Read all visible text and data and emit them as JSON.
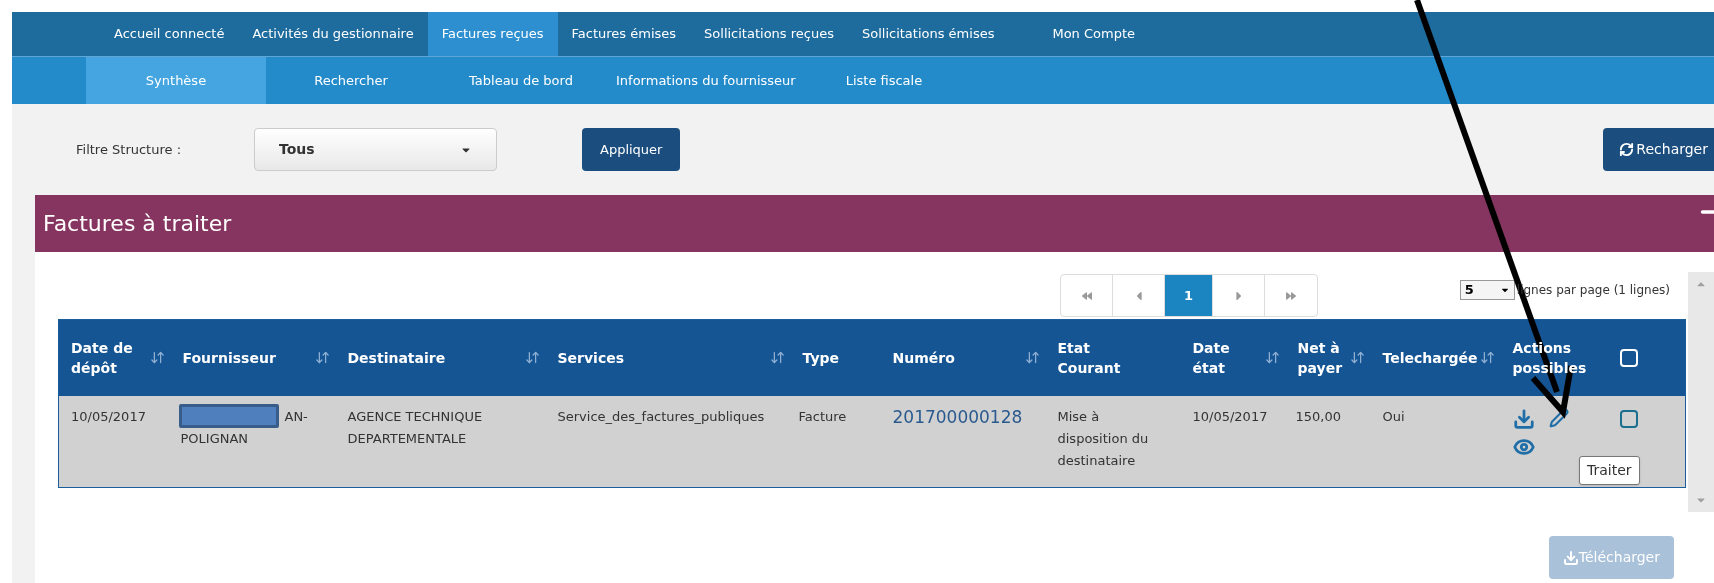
{
  "nav": {
    "tabs": [
      {
        "label": "Accueil connecté",
        "selected": false
      },
      {
        "label": "Activités du gestionnaire",
        "selected": false
      },
      {
        "label": "Factures reçues",
        "selected": true
      },
      {
        "label": "Factures émises",
        "selected": false
      },
      {
        "label": "Sollicitations reçues",
        "selected": false
      },
      {
        "label": "Sollicitations émises",
        "selected": false
      },
      {
        "label": "Mon Compte",
        "selected": false
      }
    ],
    "subtabs": [
      {
        "label": "Synthèse",
        "selected": true
      },
      {
        "label": "Rechercher",
        "selected": false
      },
      {
        "label": "Tableau de bord",
        "selected": false
      },
      {
        "label": "Informations du fournisseur",
        "selected": false
      },
      {
        "label": "Liste fiscale",
        "selected": false
      }
    ]
  },
  "filter": {
    "label": "Filtre Structure :",
    "value": "Tous",
    "apply": "Appliquer",
    "reload": "Recharger"
  },
  "panel": {
    "title": "Factures à traiter"
  },
  "pagination": {
    "pages": [
      {
        "label": "1",
        "selected": true
      }
    ],
    "per_page": "5",
    "per_page_text": "lignes par page (1 lignes)"
  },
  "table": {
    "columns": [
      {
        "label": "Date de\ndépôt",
        "sortable": true
      },
      {
        "label": "Fournisseur",
        "sortable": true
      },
      {
        "label": "Destinataire",
        "sortable": true
      },
      {
        "label": "Services",
        "sortable": true
      },
      {
        "label": "Type",
        "sortable": false
      },
      {
        "label": "Numéro",
        "sortable": true
      },
      {
        "label": "Etat\nCourant",
        "sortable": false
      },
      {
        "label": "Date\nétat",
        "sortable": true
      },
      {
        "label": "Net à\npayer",
        "sortable": true
      },
      {
        "label": "Telechargée",
        "sortable": true
      },
      {
        "label": "Actions\npossibles",
        "sortable": false
      }
    ],
    "select_all": {
      "checked": false
    },
    "rows": [
      {
        "date_depot": "10/05/2017",
        "fournisseur": "AN-\nPOLIGNAN",
        "fournisseur_redacted": true,
        "destinataire": "AGENCE TECHNIQUE\nDEPARTEMENTALE",
        "services": "Service_des_factures_publiques",
        "type": "Facture",
        "numero": "201700000128",
        "etat": "Mise à\ndisposition du\ndestinataire",
        "date_etat": "10/05/2017",
        "net": "150,00",
        "telechargee": "Oui",
        "checked": false
      }
    ]
  },
  "tooltip": "Traiter",
  "download_button": {
    "label": "Télécharger",
    "disabled": true
  }
}
